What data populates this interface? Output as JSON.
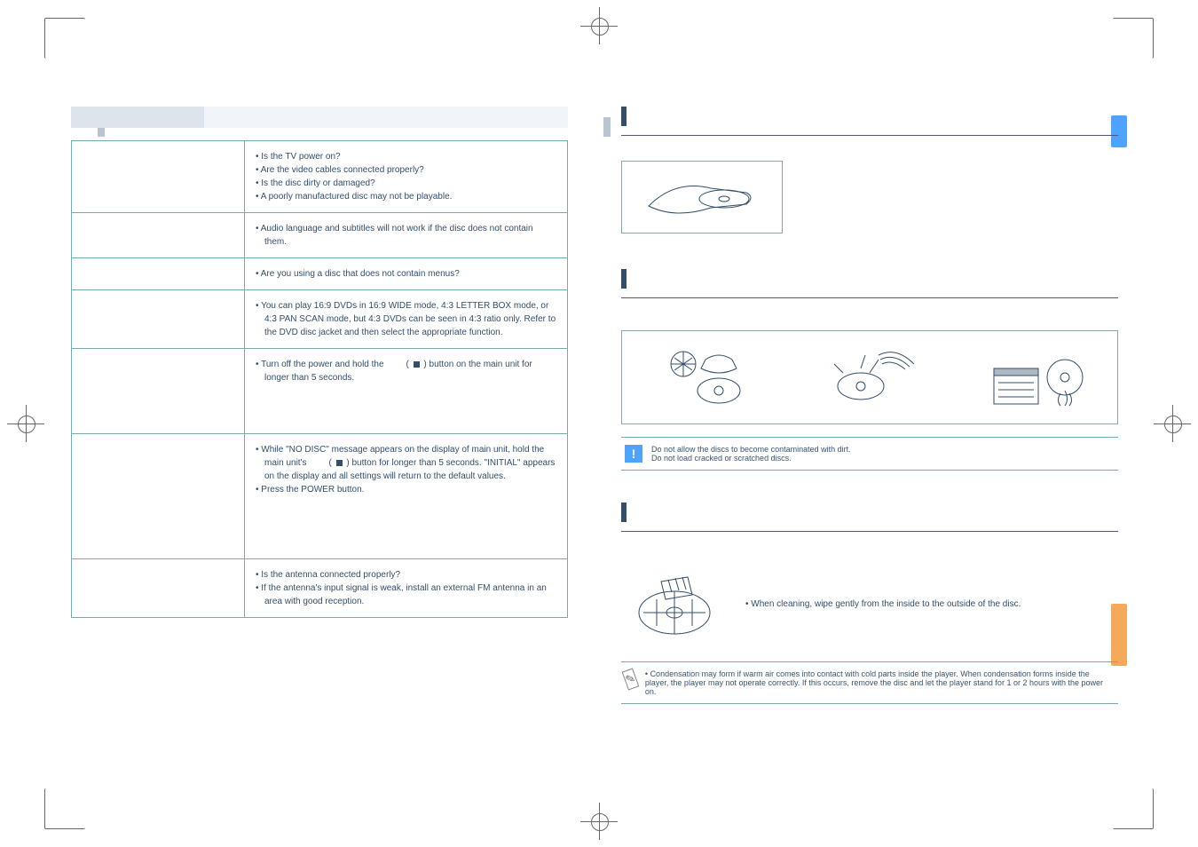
{
  "left_table": {
    "rows": [
      {
        "checks": [
          "Is the TV power on?",
          "Are the video cables connected properly?",
          "Is the disc dirty or damaged?",
          "A poorly manufactured disc may not be playable."
        ]
      },
      {
        "checks": [
          "Audio language and subtitles will not work if the disc does not contain them."
        ]
      },
      {
        "checks": [
          "Are you using a disc that does not contain menus?"
        ]
      },
      {
        "checks": [
          "You can play 16:9 DVDs in 16:9 WIDE mode, 4:3 LETTER BOX mode, or 4:3 PAN SCAN mode, but 4:3 DVDs can be seen in 4:3 ratio only. Refer to the DVD disc jacket and then select the appropriate function."
        ]
      },
      {
        "special": "power_hold"
      },
      {
        "special": "no_disc"
      },
      {
        "checks": [
          "Is the antenna connected properly?",
          "If the antenna's input signal is weak, install an external FM antenna in an area with good reception."
        ]
      }
    ],
    "power_hold_pre": "Turn off the power and hold the",
    "power_hold_post": ") button on the main unit for longer than 5 seconds.",
    "no_disc_l1": "While \"NO DISC\" message appears on the display of main unit, hold the main unit's",
    "no_disc_l2": ") button for longer than 5 seconds. \"INITIAL\" appears on the display and all settings will return to the default values.",
    "no_disc_l3": "Press the POWER button."
  },
  "right": {
    "caution_l1": "Do not allow the discs to become contaminated with dirt.",
    "caution_l2": "Do not load cracked or scratched discs.",
    "clean_text": "When cleaning, wipe gently from the inside to the outside of the disc.",
    "note_text": "Condensation may form if warm air comes into contact with cold parts inside the player. When condensation forms inside the player, the player may not operate correctly. If this occurs, remove the disc and let the player stand for 1 or 2 hours with the power on."
  }
}
